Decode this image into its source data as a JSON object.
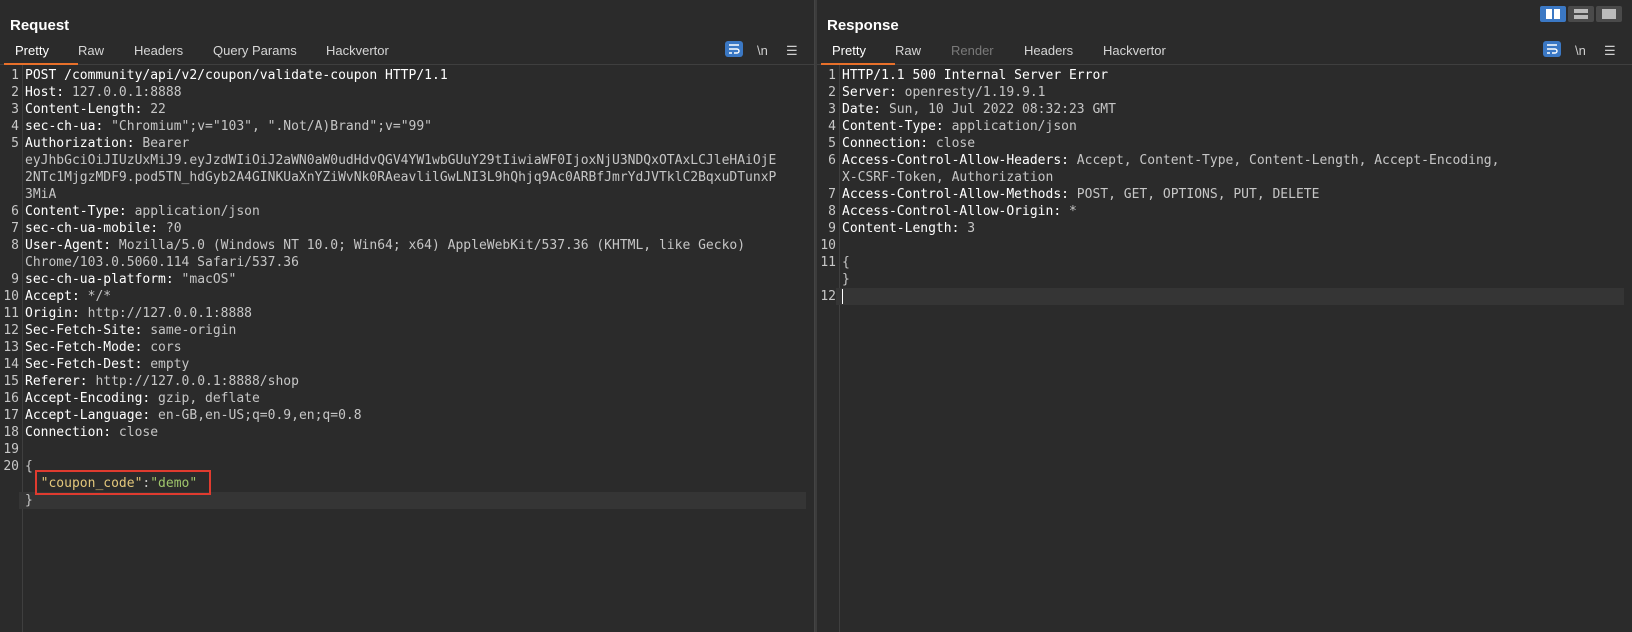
{
  "request": {
    "title": "Request",
    "tabs": [
      "Pretty",
      "Raw",
      "Headers",
      "Query Params",
      "Hackvertor"
    ],
    "tools": {
      "newline": "\\n",
      "menu": "☰"
    },
    "lines": [
      {
        "n": "1",
        "k": "POST /community/api/v2/coupon/validate-coupon HTTP/1.1",
        "v": ""
      },
      {
        "n": "2",
        "k": "Host:",
        "v": " 127.0.0.1:8888"
      },
      {
        "n": "3",
        "k": "Content-Length:",
        "v": " 22"
      },
      {
        "n": "4",
        "k": "sec-ch-ua:",
        "v": " \"Chromium\";v=\"103\", \".Not/A)Brand\";v=\"99\""
      },
      {
        "n": "5",
        "k": "Authorization:",
        "v": " Bearer"
      },
      {
        "n": "",
        "k": "",
        "v": "eyJhbGciOiJIUzUxMiJ9.eyJzdWIiOiJ2aWN0aW0udHdvQGV4YW1wbGUuY29tIiwiaWF0IjoxNjU3NDQxOTAxLCJleHAiOjE"
      },
      {
        "n": "",
        "k": "",
        "v": "2NTc1MjgzMDF9.pod5TN_hdGyb2A4GINKUaXnYZiWvNk0RAeavlilGwLNI3L9hQhjq9Ac0ARBfJmrYdJVTklC2BqxuDTunxP"
      },
      {
        "n": "",
        "k": "",
        "v": "3MiA"
      },
      {
        "n": "6",
        "k": "Content-Type:",
        "v": " application/json"
      },
      {
        "n": "7",
        "k": "sec-ch-ua-mobile:",
        "v": " ?0"
      },
      {
        "n": "8",
        "k": "User-Agent:",
        "v": " Mozilla/5.0 (Windows NT 10.0; Win64; x64) AppleWebKit/537.36 (KHTML, like Gecko)"
      },
      {
        "n": "",
        "k": "",
        "v": "Chrome/103.0.5060.114 Safari/537.36"
      },
      {
        "n": "9",
        "k": "sec-ch-ua-platform:",
        "v": " \"macOS\""
      },
      {
        "n": "10",
        "k": "Accept:",
        "v": " */*"
      },
      {
        "n": "11",
        "k": "Origin:",
        "v": " http://127.0.0.1:8888"
      },
      {
        "n": "12",
        "k": "Sec-Fetch-Site:",
        "v": " same-origin"
      },
      {
        "n": "13",
        "k": "Sec-Fetch-Mode:",
        "v": " cors"
      },
      {
        "n": "14",
        "k": "Sec-Fetch-Dest:",
        "v": " empty"
      },
      {
        "n": "15",
        "k": "Referer:",
        "v": " http://127.0.0.1:8888/shop"
      },
      {
        "n": "16",
        "k": "Accept-Encoding:",
        "v": " gzip, deflate"
      },
      {
        "n": "17",
        "k": "Accept-Language:",
        "v": " en-GB,en-US;q=0.9,en;q=0.8"
      },
      {
        "n": "18",
        "k": "Connection:",
        "v": " close"
      },
      {
        "n": "19",
        "k": "",
        "v": ""
      },
      {
        "n": "20",
        "k": "",
        "v": "{"
      },
      {
        "n": "",
        "k": "",
        "v": "",
        "json": {
          "key": "\"coupon_code\"",
          "sep": ":",
          "val": "\"demo\""
        }
      },
      {
        "n": "",
        "k": "",
        "v": "}"
      }
    ]
  },
  "response": {
    "title": "Response",
    "tabs": [
      "Pretty",
      "Raw",
      "Render",
      "Headers",
      "Hackvertor"
    ],
    "tools": {
      "newline": "\\n",
      "menu": "☰"
    },
    "lines": [
      {
        "n": "1",
        "k": "HTTP/1.1 500 Internal Server Error",
        "v": ""
      },
      {
        "n": "2",
        "k": "Server:",
        "v": " openresty/1.19.9.1"
      },
      {
        "n": "3",
        "k": "Date:",
        "v": " Sun, 10 Jul 2022 08:32:23 GMT"
      },
      {
        "n": "4",
        "k": "Content-Type:",
        "v": " application/json"
      },
      {
        "n": "5",
        "k": "Connection:",
        "v": " close"
      },
      {
        "n": "6",
        "k": "Access-Control-Allow-Headers:",
        "v": " Accept, Content-Type, Content-Length, Accept-Encoding,"
      },
      {
        "n": "",
        "k": "",
        "v": "X-CSRF-Token, Authorization"
      },
      {
        "n": "7",
        "k": "Access-Control-Allow-Methods:",
        "v": " POST, GET, OPTIONS, PUT, DELETE"
      },
      {
        "n": "8",
        "k": "Access-Control-Allow-Origin:",
        "v": " *"
      },
      {
        "n": "9",
        "k": "Content-Length:",
        "v": " 3"
      },
      {
        "n": "10",
        "k": "",
        "v": ""
      },
      {
        "n": "11",
        "k": "",
        "v": "{"
      },
      {
        "n": "",
        "k": "",
        "v": "}"
      },
      {
        "n": "12",
        "k": "",
        "v": "",
        "cursor": true
      }
    ]
  },
  "colors": {
    "accent": "#e8702a",
    "highlight_box": "#e03b2f",
    "toggle_blue": "#3b78c4"
  }
}
